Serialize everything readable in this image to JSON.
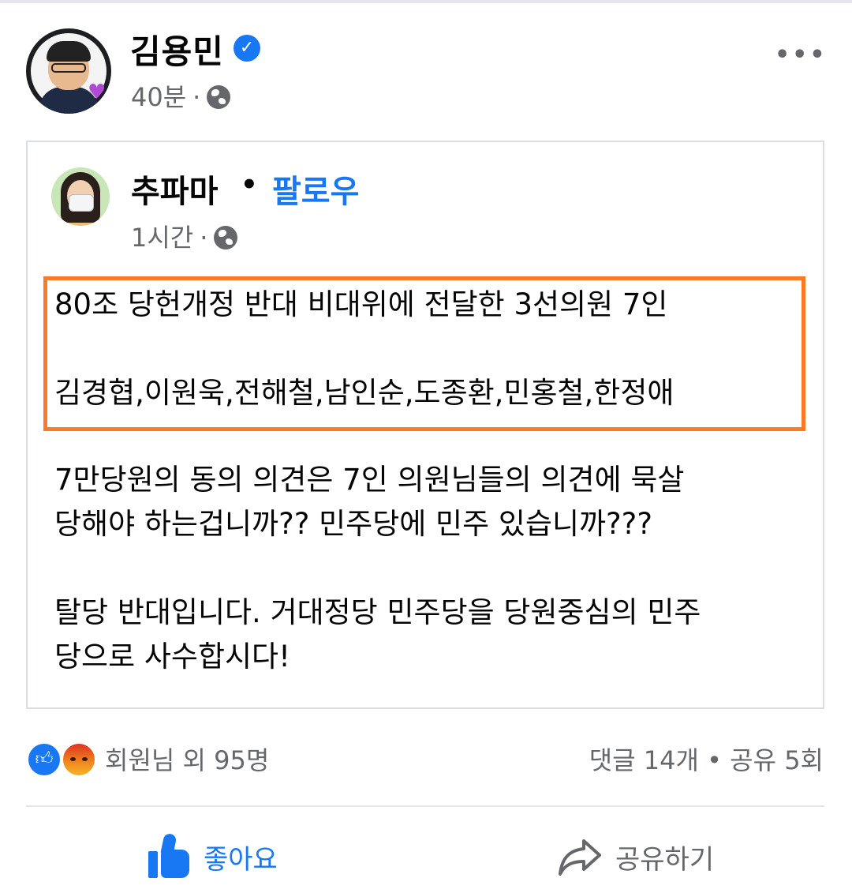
{
  "post": {
    "author": "김용민",
    "time": "40분",
    "separator": "·"
  },
  "shared": {
    "author": "추파마",
    "separator": "•",
    "follow_label": "팔로우",
    "time": "1시간",
    "highlight_lines": [
      "80조 당헌개정 반대 비대위에 전달한 3선의원 7인",
      "김경협,이원욱,전해철,남인순,도종환,민홍철,한정애"
    ],
    "body_lines": [
      "7만당원의 동의 의견은 7인 의원님들의 의견에 묵살",
      "당해야 하는겁니까?? 민주당에 민주 있습니까???",
      "탈당 반대입니다. 거대정당 민주당을 당원중심의 민주",
      "당으로 사수합시다!"
    ]
  },
  "reactions": {
    "summary": "회원님 외 95명",
    "stats": "댓글 14개 • 공유 5회",
    "types": [
      "like-icon",
      "angry-icon"
    ]
  },
  "actions": {
    "like": "좋아요",
    "share": "공유하기"
  },
  "colors": {
    "accent": "#1877f2",
    "highlight_border": "#fb7a26",
    "muted_text": "#65676b"
  }
}
